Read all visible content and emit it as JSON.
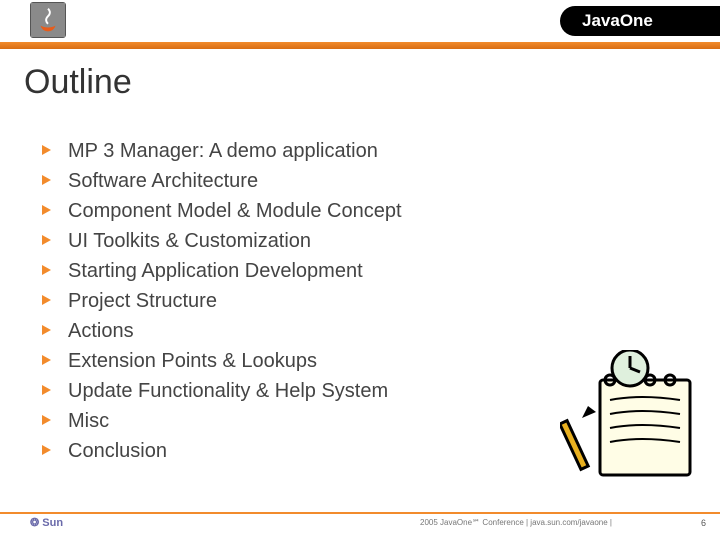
{
  "header": {
    "java_logo_name": "java-logo",
    "brand": "JavaOne"
  },
  "title": "Outline",
  "bullets": [
    "MP 3 Manager: A demo application",
    "Software Architecture",
    "Component Model & Module Concept",
    "UI Toolkits & Customization",
    "Starting Application Development",
    "Project Structure",
    "Actions",
    "Extension Points & Lookups",
    "Update Functionality & Help System",
    "Misc",
    "Conclusion"
  ],
  "footer": {
    "sun_logo_text": "❂ Sun",
    "center_text": "2005 JavaOne℠ Conference  |  java.sun.com/javaone  |",
    "page_number": "6"
  },
  "colors": {
    "accent": "#f28b2c",
    "text": "#444"
  }
}
